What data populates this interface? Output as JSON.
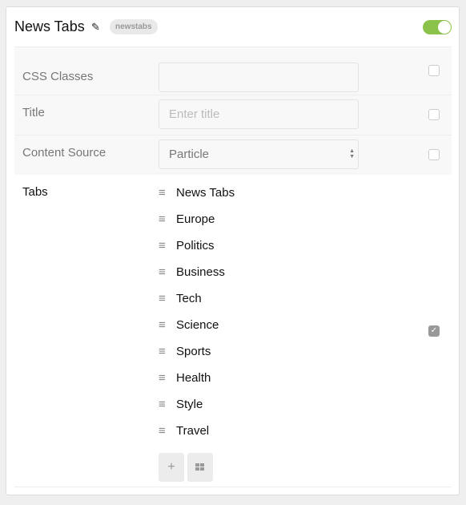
{
  "header": {
    "title": "News Tabs",
    "badge": "newstabs",
    "enabled": true
  },
  "fields": {
    "css_classes": {
      "label": "CSS Classes",
      "value": ""
    },
    "title": {
      "label": "Title",
      "placeholder": "Enter title"
    },
    "content_source": {
      "label": "Content Source",
      "value": "Particle"
    }
  },
  "tabs": {
    "label": "Tabs",
    "items": [
      "News Tabs",
      "Europe",
      "Politics",
      "Business",
      "Tech",
      "Science",
      "Sports",
      "Health",
      "Style",
      "Travel"
    ],
    "add_label": "+"
  }
}
